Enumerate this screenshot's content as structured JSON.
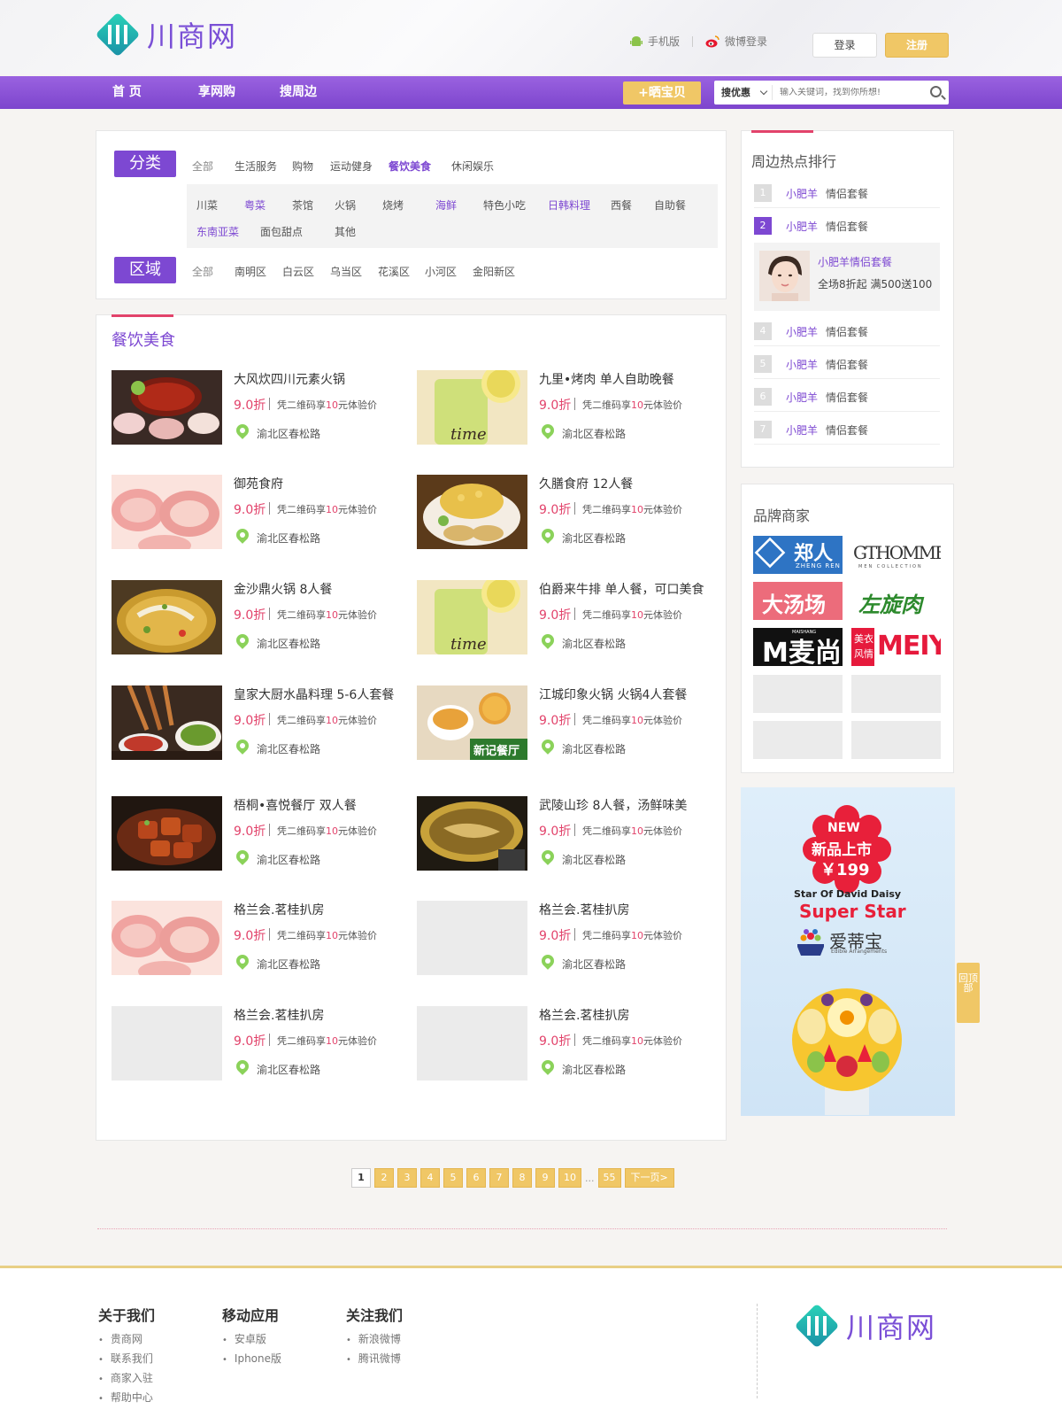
{
  "header": {
    "logo_text": "川商网",
    "mobile_label": "手机版",
    "weibo_label": "微博登录",
    "login_label": "登录",
    "register_label": "注册"
  },
  "nav": {
    "items": [
      "首 页",
      "享网购",
      "搜周边"
    ],
    "show_button": "+晒宝贝",
    "search_select": "搜优惠",
    "search_placeholder": "输入关键词，找到你所想!"
  },
  "filter": {
    "category_label": "分类",
    "categories": [
      "全部",
      "生活服务",
      "购物",
      "运动健身",
      "餐饮美食",
      "休闲娱乐"
    ],
    "subcategories_row1": [
      "川菜",
      "粤菜",
      "茶馆",
      "火锅",
      "烧烤",
      "海鲜",
      "特色小吃",
      "日韩料理",
      "西餐",
      "自助餐"
    ],
    "subcategories_row2": [
      "东南亚菜",
      "面包甜点",
      "其他"
    ],
    "area_label": "区域",
    "areas": [
      "全部",
      "南明区",
      "白云区",
      "乌当区",
      "花溪区",
      "小河区",
      "金阳新区"
    ]
  },
  "listing": {
    "title": "餐饮美食",
    "price": "9.0折",
    "deal_prefix": "凭二维码享",
    "deal_amount": "10",
    "deal_suffix": "元体验价",
    "location": "渝北区春松路",
    "items": [
      {
        "name": "大风炊四川元素火锅",
        "img": "hotpot"
      },
      {
        "name": "九里•烤肉 单人自助晚餐",
        "img": "drink"
      },
      {
        "name": "御苑食府",
        "img": "meat"
      },
      {
        "name": "久膳食府 12人餐",
        "img": "corn"
      },
      {
        "name": "金沙鼎火锅 8人餐",
        "img": "fishsoup"
      },
      {
        "name": "伯爵来牛排 单人餐，可口美食",
        "img": "drink"
      },
      {
        "name": "皇家大厨水晶料理 5-6人套餐",
        "img": "skewers"
      },
      {
        "name": "江城印象火锅 火锅4人套餐",
        "img": "tea"
      },
      {
        "name": "梧桐•喜悦餐厅 双人餐",
        "img": "pork"
      },
      {
        "name": "武陵山珍 8人餐，汤鲜味美",
        "img": "soup"
      },
      {
        "name": "格兰会.茗桂扒房",
        "img": "meat"
      },
      {
        "name": "格兰会.茗桂扒房",
        "img": "none"
      },
      {
        "name": "格兰会.茗桂扒房",
        "img": "none"
      },
      {
        "name": "格兰会.茗桂扒房",
        "img": "none"
      }
    ]
  },
  "rank": {
    "title": "周边热点排行",
    "rows": [
      {
        "num": "1",
        "shop": "小肥羊",
        "deal": "情侣套餐"
      },
      {
        "num": "2",
        "shop": "小肥羊",
        "deal": "情侣套餐"
      },
      {
        "num": "4",
        "shop": "小肥羊",
        "deal": "情侣套餐"
      },
      {
        "num": "5",
        "shop": "小肥羊",
        "deal": "情侣套餐"
      },
      {
        "num": "6",
        "shop": "小肥羊",
        "deal": "情侣套餐"
      },
      {
        "num": "7",
        "shop": "小肥羊",
        "deal": "情侣套餐"
      }
    ],
    "featured": {
      "title": "小肥羊情侣套餐",
      "desc": "全场8折起  满500送100"
    }
  },
  "brands": {
    "title": "品牌商家",
    "logos": [
      {
        "text": "郑人",
        "sub": "ZHENG REN"
      },
      {
        "text": "GTHOMME",
        "sub": "MEN COLLECTION"
      },
      {
        "text": "大汤场",
        "sub": ""
      },
      {
        "text": "左旋肉碱",
        "sub": ""
      },
      {
        "text": "M麦尚",
        "sub": "MAISHANG"
      },
      {
        "text": "MEIYI",
        "sub": "美衣风情"
      }
    ]
  },
  "ad": {
    "badge_new": "NEW",
    "badge_line": "新品上市",
    "badge_price": "￥199",
    "line1": "Star Of David Daisy",
    "line2": "Super Star",
    "brand": "爱蒂宝",
    "brand_sub": "Edible Arrangements"
  },
  "back_top": "回顶部",
  "pager": {
    "pages": [
      "1",
      "2",
      "3",
      "4",
      "5",
      "6",
      "7",
      "8",
      "9",
      "10"
    ],
    "dots": "...",
    "last": "55",
    "next": "下一页>"
  },
  "footer": {
    "cols": [
      {
        "title": "关于我们",
        "links": [
          "贵商网",
          "联系我们",
          "商家入驻",
          "帮助中心"
        ]
      },
      {
        "title": "移动应用",
        "links": [
          "安卓版",
          "Iphone版"
        ]
      },
      {
        "title": "关注我们",
        "links": [
          "新浪微博",
          "腾讯微博"
        ]
      }
    ],
    "logo_text": "川商网"
  },
  "colors": {
    "accent": "#7d48d2",
    "price": "#e2436b",
    "gold": "#f0c766"
  }
}
